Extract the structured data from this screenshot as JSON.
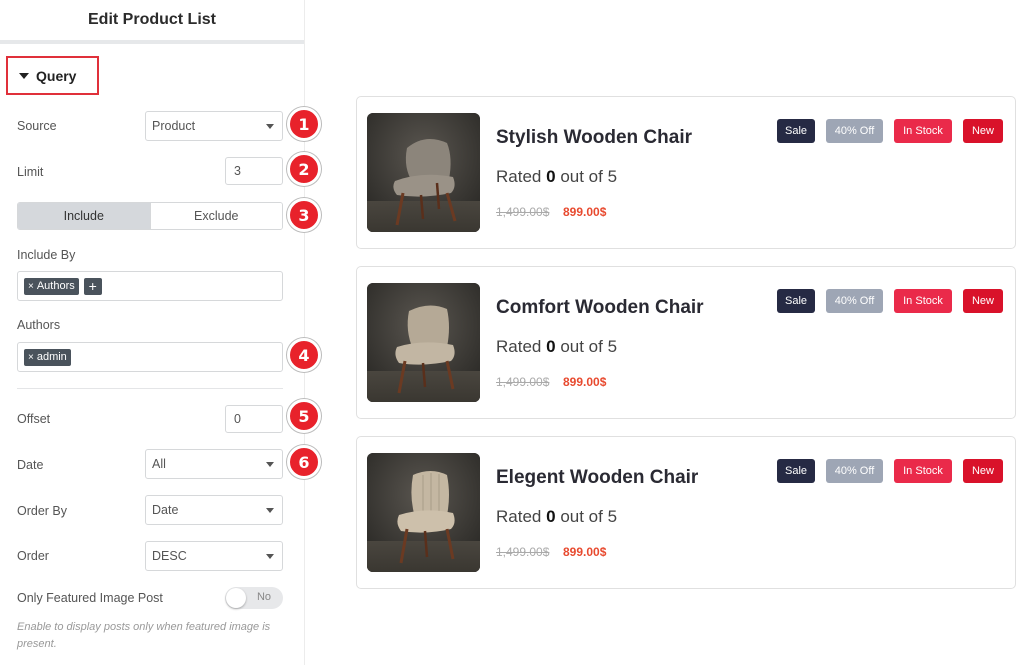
{
  "panel": {
    "title": "Edit Product List",
    "section_title": "Query",
    "source": {
      "label": "Source",
      "value": "Product"
    },
    "limit": {
      "label": "Limit",
      "value": "3"
    },
    "include_tab": "Include",
    "exclude_tab": "Exclude",
    "include_by": {
      "label": "Include By",
      "tag": "Authors",
      "add": "+"
    },
    "authors": {
      "label": "Authors",
      "tag": "admin"
    },
    "offset": {
      "label": "Offset",
      "value": "0"
    },
    "date": {
      "label": "Date",
      "value": "All"
    },
    "order_by": {
      "label": "Order By",
      "value": "Date"
    },
    "order": {
      "label": "Order",
      "value": "DESC"
    },
    "featured": {
      "label": "Only Featured Image Post",
      "toggle_text": "No"
    },
    "help": "Enable to display posts only when featured image is present."
  },
  "markers": [
    "1",
    "2",
    "3",
    "4",
    "5",
    "6"
  ],
  "products": [
    {
      "title": "Stylish Wooden Chair",
      "rating_prefix": "Rated",
      "rating": "0",
      "rating_suffix": "out of 5",
      "old_price": "1,499.00$",
      "new_price": "899.00$"
    },
    {
      "title": "Comfort Wooden Chair",
      "rating_prefix": "Rated",
      "rating": "0",
      "rating_suffix": "out of 5",
      "old_price": "1,499.00$",
      "new_price": "899.00$"
    },
    {
      "title": "Elegent Wooden Chair",
      "rating_prefix": "Rated",
      "rating": "0",
      "rating_suffix": "out of 5",
      "old_price": "1,499.00$",
      "new_price": "899.00$"
    }
  ],
  "badges": {
    "sale": "Sale",
    "off": "40% Off",
    "stock": "In Stock",
    "new": "New"
  },
  "colors": {
    "marker": "#e8222b",
    "highlight_border": "#e0303a",
    "sale": "#262a44",
    "off": "#9ea6b5",
    "stock": "#ea2a4a",
    "new": "#d9122a",
    "price": "#e84a2f"
  }
}
